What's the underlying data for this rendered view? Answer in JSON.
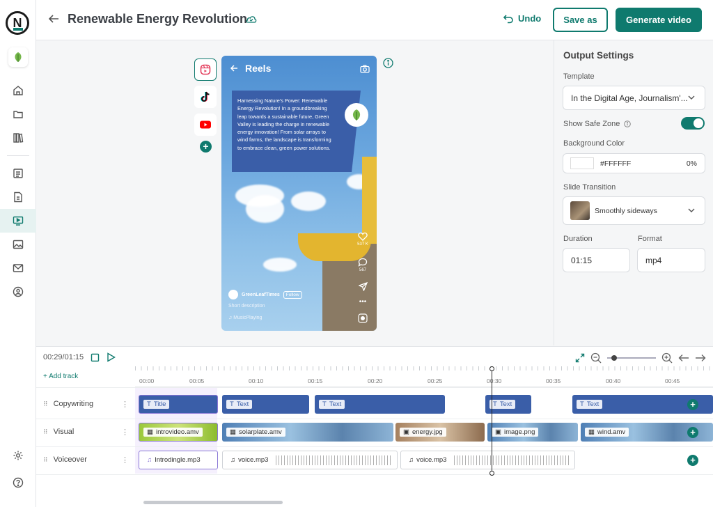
{
  "app": {
    "logo_letter": "N"
  },
  "header": {
    "title": "Renewable Energy Revolution",
    "undo_label": "Undo",
    "save_as_label": "Save as",
    "generate_label": "Generate video"
  },
  "sidebar": {
    "items": [
      {
        "icon": "home-icon"
      },
      {
        "icon": "folder-icon"
      },
      {
        "icon": "library-icon"
      },
      {
        "icon": "list-icon"
      },
      {
        "icon": "document-icon"
      },
      {
        "icon": "video-icon",
        "active": true
      },
      {
        "icon": "image-icon"
      },
      {
        "icon": "mail-icon"
      },
      {
        "icon": "user-add-icon"
      },
      {
        "icon": "settings-icon"
      },
      {
        "icon": "help-icon"
      }
    ]
  },
  "preview": {
    "platforms": [
      {
        "name": "instagram-reels",
        "active": true
      },
      {
        "name": "tiktok"
      },
      {
        "name": "youtube"
      }
    ],
    "phone": {
      "header": "Reels",
      "caption": "Harnessing Nature's Power: Renewable Energy Revolution! In a groundbreaking leap towards a sustainable future, Green Valley is leading the charge in renewable energy innovation! From solar arrays to wind farms, the landscape is transforming to embrace clean, green power solutions.",
      "likes": "537 K",
      "comments": "567",
      "username": "GreenLeafTimes",
      "follow": "Follow",
      "description": "Short description",
      "music": "MusicPlaying"
    }
  },
  "settings": {
    "title": "Output Settings",
    "template_label": "Template",
    "template_value": "In the Digital Age, Journalism'...",
    "safe_zone_label": "Show Safe Zone",
    "safe_zone_on": true,
    "bg_color_label": "Background Color",
    "bg_color_value": "#FFFFFF",
    "bg_opacity": "0%",
    "transition_label": "Slide Transition",
    "transition_value": "Smoothly sideways",
    "duration_label": "Duration",
    "duration_value": "01:15",
    "format_label": "Format",
    "format_value": "mp4"
  },
  "timeline": {
    "time": "00:29/01:15",
    "add_track": "+ Add track",
    "ticks": [
      "00:00",
      "00:05",
      "00:10",
      "00:15",
      "00:20",
      "00:25",
      "00:30",
      "00:35",
      "00:40",
      "00:45"
    ],
    "tracks": [
      {
        "name": "Copywriting",
        "clips": [
          "Title",
          "Text",
          "Text",
          "Text",
          "Text"
        ]
      },
      {
        "name": "Visual",
        "clips": [
          "introvideo.amv",
          "solarplate.amv",
          "energy.jpg",
          "image.png",
          "wind.amv"
        ]
      },
      {
        "name": "Voiceover",
        "clips": [
          "Introdingle.mp3",
          "voice.mp3",
          "voice.mp3"
        ]
      }
    ]
  },
  "colors": {
    "accent": "#0f7a6e",
    "text_clip": "#3a5ea8"
  }
}
